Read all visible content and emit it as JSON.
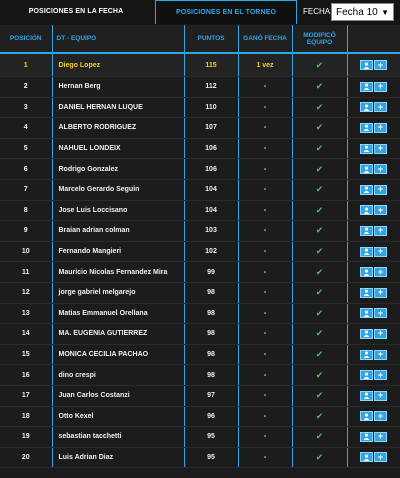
{
  "tabs": {
    "active": "POSICIONES EN LA FECHA",
    "inactive": "POSICIONES EN EL TORNEO"
  },
  "fecha": {
    "label": "FECHA:",
    "selected": "Fecha 10"
  },
  "table": {
    "headers": {
      "pos": "POSICIÓN",
      "team": "DT - EQUIPO",
      "points": "PUNTOS",
      "won": "GANÓ FECHA",
      "modified": "MODIFICÓ EQUIPO"
    },
    "rows": [
      {
        "pos": "1",
        "name": "Diego Lopez",
        "points": "115",
        "won": "1 vez"
      },
      {
        "pos": "2",
        "name": "Hernan Berg",
        "points": "112",
        "won": "-"
      },
      {
        "pos": "3",
        "name": "DANIEL HERNAN LUQUE",
        "points": "110",
        "won": "-"
      },
      {
        "pos": "4",
        "name": "ALBERTO RODRIGUEZ",
        "points": "107",
        "won": "-"
      },
      {
        "pos": "5",
        "name": "NAHUEL LONDEIX",
        "points": "106",
        "won": "-"
      },
      {
        "pos": "6",
        "name": "Rodrigo Gonzalez",
        "points": "106",
        "won": "-"
      },
      {
        "pos": "7",
        "name": "Marcelo Gerardo Seguin",
        "points": "104",
        "won": "-"
      },
      {
        "pos": "8",
        "name": "Jose Luis Loccisano",
        "points": "104",
        "won": "-"
      },
      {
        "pos": "9",
        "name": "Braian adrian colman",
        "points": "103",
        "won": "-"
      },
      {
        "pos": "10",
        "name": "Fernando Mangieri",
        "points": "102",
        "won": "-"
      },
      {
        "pos": "11",
        "name": "Mauricio Nicolas Fernandez Mira",
        "points": "99",
        "won": "-"
      },
      {
        "pos": "12",
        "name": "jorge gabriel melgarejo",
        "points": "98",
        "won": "-"
      },
      {
        "pos": "13",
        "name": "Matias Emmanuel Orellana",
        "points": "98",
        "won": "-"
      },
      {
        "pos": "14",
        "name": "MA. EUGENIA GUTIERREZ",
        "points": "98",
        "won": "-"
      },
      {
        "pos": "15",
        "name": "MONICA CECILIA PACHAO",
        "points": "98",
        "won": "-"
      },
      {
        "pos": "16",
        "name": "dino crespi",
        "points": "98",
        "won": "-"
      },
      {
        "pos": "17",
        "name": "Juan Carlos Costanzi",
        "points": "97",
        "won": "-"
      },
      {
        "pos": "18",
        "name": "Otto Kexel",
        "points": "96",
        "won": "-"
      },
      {
        "pos": "19",
        "name": "sebastian tacchetti",
        "points": "95",
        "won": "-"
      },
      {
        "pos": "20",
        "name": "Luis Adrian Diaz",
        "points": "95",
        "won": "-"
      }
    ]
  },
  "colors": {
    "accent": "#2ea6e6",
    "leader": "#f5d020",
    "check": "#44c24a",
    "background": "#1c1c1c"
  },
  "icons": {
    "modified": "check-icon",
    "view": "user-icon",
    "add": "plus-icon"
  }
}
